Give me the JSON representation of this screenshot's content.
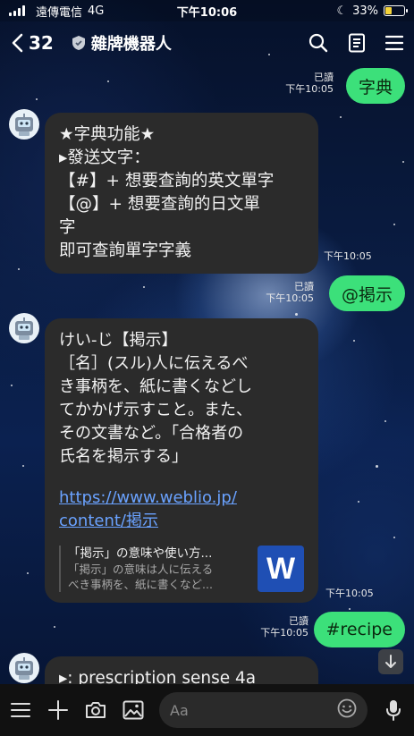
{
  "status_bar": {
    "carrier": "遠傳電信",
    "network": "4G",
    "time": "下午10:06",
    "battery": "33%",
    "battery_level": 0.33
  },
  "header": {
    "back_count": "32",
    "title": "雜牌機器人"
  },
  "messages": {
    "m1": {
      "text": "字典",
      "read": "已讀",
      "time": "下午10:05"
    },
    "m2": {
      "lines": [
        "★字典功能★",
        "▸發送文字：",
        "【#】+ 想要查詢的英文單字",
        "【@】+ 想要查詢的日文單",
        "字",
        "即可查詢單字字義"
      ],
      "time": "下午10:05"
    },
    "m3": {
      "text": "@掲示",
      "read": "已讀",
      "time": "下午10:05"
    },
    "m4": {
      "lines": [
        "けい-じ【掲示】",
        "［名］(スル)人に伝えるべ",
        "き事柄を、紙に書くなどし",
        "てかかげ示すこと。また、",
        "その文書など。「合格者の",
        "氏名を掲示する」"
      ],
      "link_lines": [
        "https://www.weblio.jp/",
        "content/掲示"
      ],
      "preview_title": "「掲示」の意味や使い方...",
      "preview_desc": [
        "「掲示」の意味は人に伝える",
        "べき事柄を、紙に書くなど..."
      ],
      "preview_logo": "W",
      "time": "下午10:05"
    },
    "m5": {
      "text": "#recipe",
      "read": "已讀",
      "time": "下午10:05"
    },
    "m6": {
      "text": "▸: prescription sense 4a"
    }
  },
  "input": {
    "placeholder": "Aa"
  },
  "colors": {
    "outgoing_bubble": "#3ce07a",
    "incoming_bubble": "#2b2b2b",
    "link": "#6aa2ff"
  }
}
